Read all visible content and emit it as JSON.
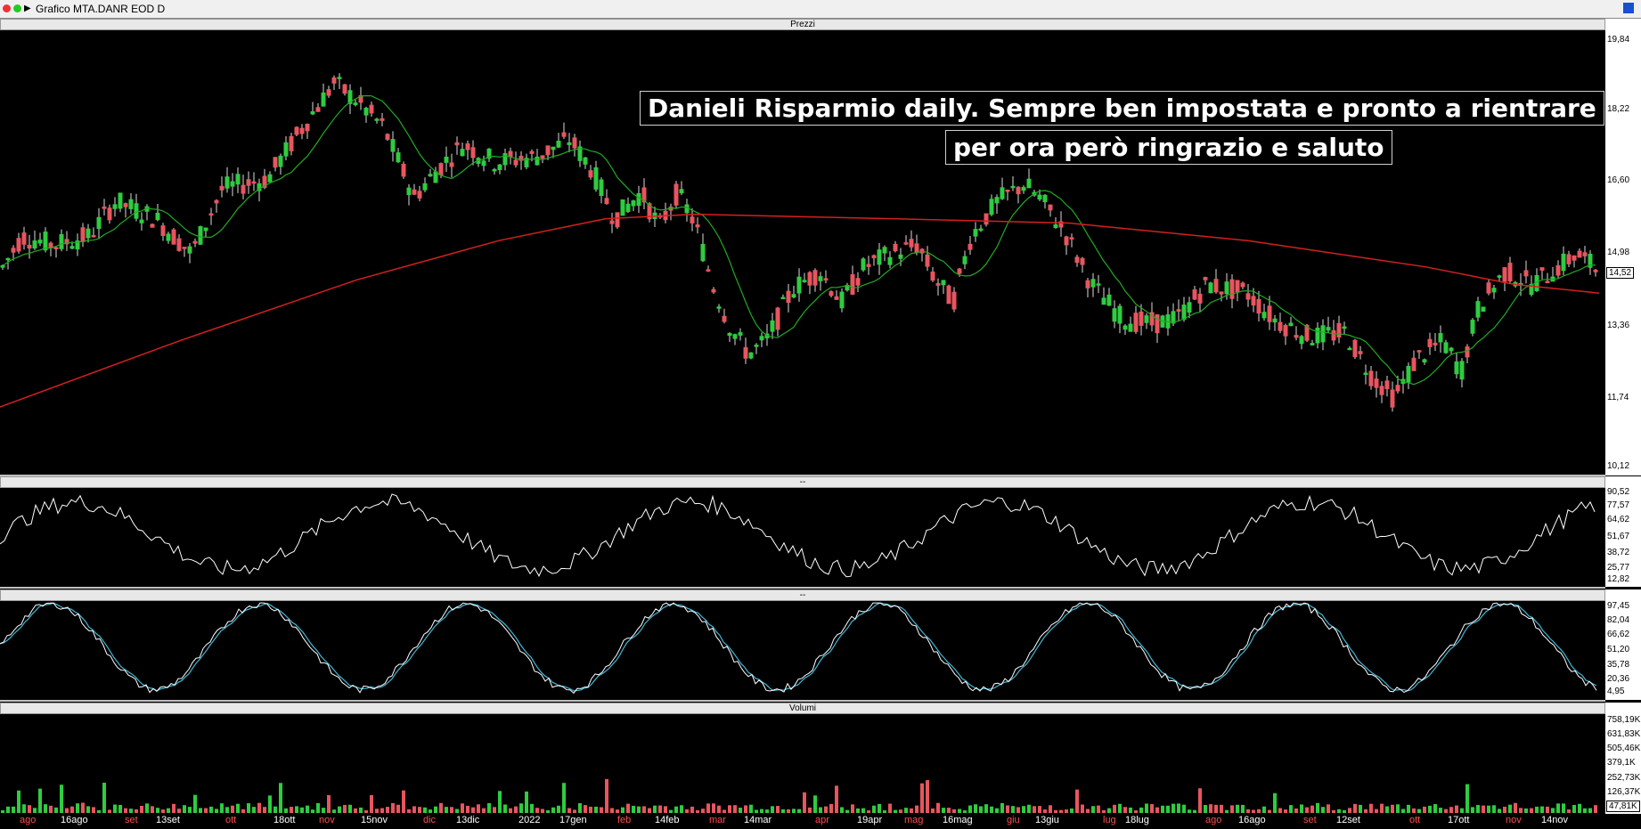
{
  "window": {
    "title": "Grafico MTA.DANR EOD D"
  },
  "panels": {
    "price": {
      "header": "Prezzi",
      "axis": [
        "19,84",
        "18,22",
        "16,60",
        "14,98",
        "13,36",
        "11,74",
        "10,12"
      ],
      "last": "14,52"
    },
    "ind1": {
      "header": "--",
      "axis": [
        "90,52",
        "77,57",
        "64,62",
        "51,67",
        "38,72",
        "25,77",
        "12,82"
      ]
    },
    "ind2": {
      "header": "--",
      "axis": [
        "97,45",
        "82,04",
        "66,62",
        "51,20",
        "35,78",
        "20,36",
        "4,95"
      ]
    },
    "volume": {
      "header": "Volumi",
      "axis": [
        "758,19K",
        "631,83K",
        "505,46K",
        "379,1K",
        "252,73K",
        "126,37K"
      ],
      "last": "47,81K"
    }
  },
  "annotation": {
    "line1": "Danieli Risparmio daily. Sempre ben impostata e pronto a rientrare",
    "line2": "per ora però ringrazio e saluto"
  },
  "x_labels": [
    {
      "t": "ago",
      "c": "#ff4d4d"
    },
    {
      "t": "16ago",
      "c": "#ffffff"
    },
    {
      "t": "set",
      "c": "#ff4d4d"
    },
    {
      "t": "13set",
      "c": "#ffffff"
    },
    {
      "t": "ott",
      "c": "#ff4d4d"
    },
    {
      "t": "18ott",
      "c": "#ffffff"
    },
    {
      "t": "nov",
      "c": "#ff4d4d"
    },
    {
      "t": "15nov",
      "c": "#ffffff"
    },
    {
      "t": "dic",
      "c": "#ff4d4d"
    },
    {
      "t": "13dic",
      "c": "#ffffff"
    },
    {
      "t": "2022",
      "c": "#ffffff"
    },
    {
      "t": "17gen",
      "c": "#ffffff"
    },
    {
      "t": "feb",
      "c": "#ff4d4d"
    },
    {
      "t": "14feb",
      "c": "#ffffff"
    },
    {
      "t": "mar",
      "c": "#ff4d4d"
    },
    {
      "t": "14mar",
      "c": "#ffffff"
    },
    {
      "t": "apr",
      "c": "#ff4d4d"
    },
    {
      "t": "19apr",
      "c": "#ffffff"
    },
    {
      "t": "mag",
      "c": "#ff4d4d"
    },
    {
      "t": "16mag",
      "c": "#ffffff"
    },
    {
      "t": "giu",
      "c": "#ff4d4d"
    },
    {
      "t": "13giu",
      "c": "#ffffff"
    },
    {
      "t": "lug",
      "c": "#ff4d4d"
    },
    {
      "t": "18lug",
      "c": "#ffffff"
    },
    {
      "t": "ago",
      "c": "#ff4d4d"
    },
    {
      "t": "16ago",
      "c": "#ffffff"
    },
    {
      "t": "set",
      "c": "#ff4d4d"
    },
    {
      "t": "12set",
      "c": "#ffffff"
    },
    {
      "t": "ott",
      "c": "#ff4d4d"
    },
    {
      "t": "17ott",
      "c": "#ffffff"
    },
    {
      "t": "nov",
      "c": "#ff4d4d"
    },
    {
      "t": "14nov",
      "c": "#ffffff"
    }
  ],
  "colors": {
    "up": "#2ecc40",
    "down": "#e8555f",
    "ma_short": "#22aa22",
    "ma_long": "#d42020",
    "osc": "#ffffff",
    "stoch_k": "#ffffff",
    "stoch_d": "#3fb8d6"
  }
}
